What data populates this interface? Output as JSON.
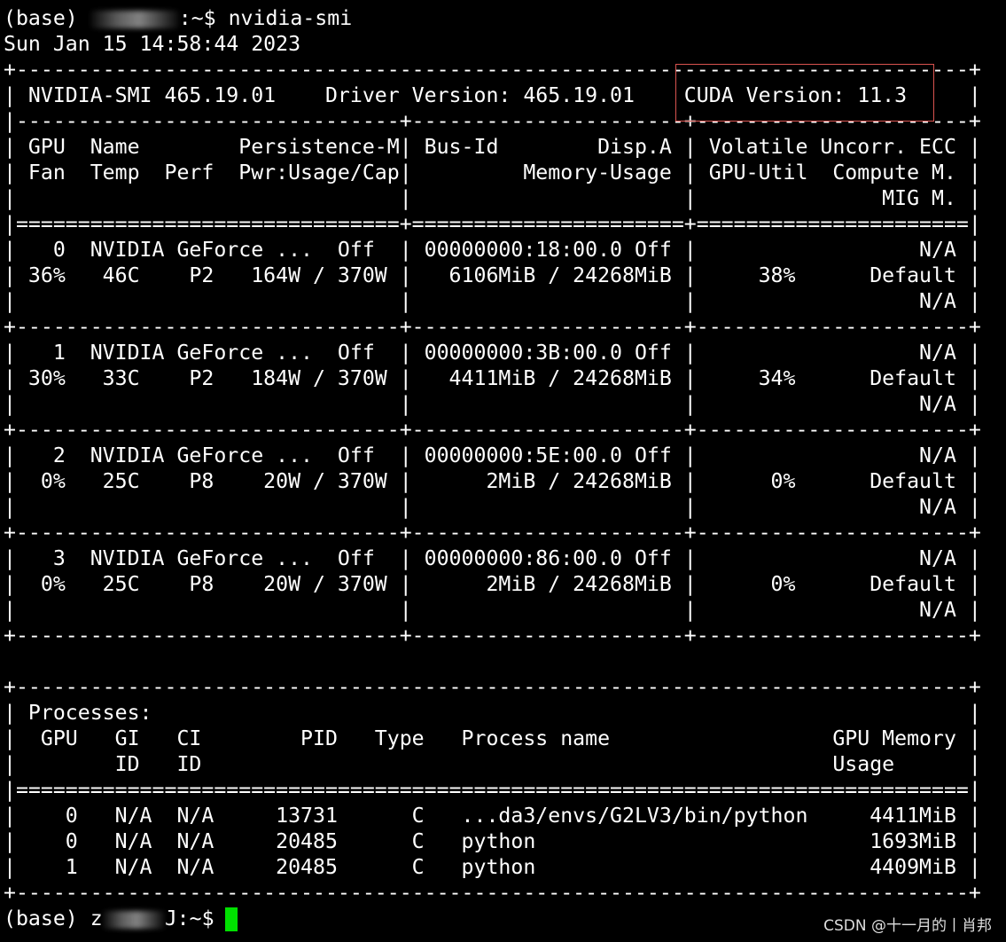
{
  "prompt_top": {
    "prefix": "(base) ",
    "suffix": ":~$ nvidia-smi"
  },
  "timestamp": "Sun Jan 15 14:58:44 2023",
  "smi_lines": [
    "+-----------------------------------------------------------------------------+",
    "| NVIDIA-SMI 465.19.01    Driver Version: 465.19.01    CUDA Version: 11.3     |",
    "|-------------------------------+----------------------+----------------------+",
    "| GPU  Name        Persistence-M| Bus-Id        Disp.A | Volatile Uncorr. ECC |",
    "| Fan  Temp  Perf  Pwr:Usage/Cap|         Memory-Usage | GPU-Util  Compute M. |",
    "|                               |                      |               MIG M. |",
    "|===============================+======================+======================|",
    "|   0  NVIDIA GeForce ...  Off  | 00000000:18:00.0 Off |                  N/A |",
    "| 36%   46C    P2   164W / 370W |   6106MiB / 24268MiB |     38%      Default |",
    "|                               |                      |                  N/A |",
    "+-------------------------------+----------------------+----------------------+",
    "|   1  NVIDIA GeForce ...  Off  | 00000000:3B:00.0 Off |                  N/A |",
    "| 30%   33C    P2   184W / 370W |   4411MiB / 24268MiB |     34%      Default |",
    "|                               |                      |                  N/A |",
    "+-------------------------------+----------------------+----------------------+",
    "|   2  NVIDIA GeForce ...  Off  | 00000000:5E:00.0 Off |                  N/A |",
    "|  0%   25C    P8    20W / 370W |      2MiB / 24268MiB |      0%      Default |",
    "|                               |                      |                  N/A |",
    "+-------------------------------+----------------------+----------------------+",
    "|   3  NVIDIA GeForce ...  Off  | 00000000:86:00.0 Off |                  N/A |",
    "|  0%   25C    P8    20W / 370W |      2MiB / 24268MiB |      0%      Default |",
    "|                               |                      |                  N/A |",
    "+-------------------------------+----------------------+----------------------+",
    "",
    "+-----------------------------------------------------------------------------+",
    "| Processes:                                                                  |",
    "|  GPU   GI   CI        PID   Type   Process name                  GPU Memory |",
    "|        ID   ID                                                   Usage      |",
    "|=============================================================================|",
    "|    0   N/A  N/A     13731      C   ...da3/envs/G2LV3/bin/python     4411MiB |",
    "|    0   N/A  N/A     20485      C   python                           1693MiB |",
    "|    1   N/A  N/A     20485      C   python                           4409MiB |",
    "+-----------------------------------------------------------------------------+"
  ],
  "prompt_bottom": {
    "prefix": "(base) z",
    "suffix": "J:~$"
  },
  "watermark": "CSDN @十一月的丨肖邦",
  "colors": {
    "background": "#000000",
    "text": "#ffffff",
    "cursor": "#00e000",
    "highlight_border": "#d9534f"
  }
}
